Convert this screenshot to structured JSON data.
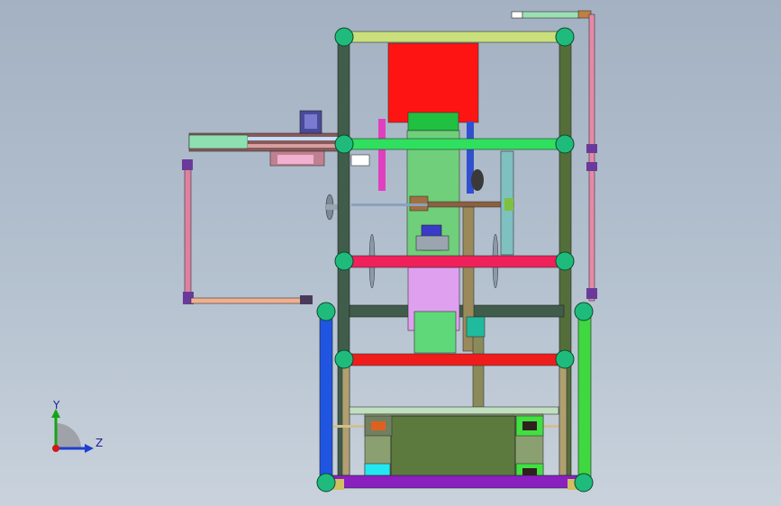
{
  "viewport": {
    "background_top": "#a3b1c2",
    "background_bottom": "#c9d2dc"
  },
  "triad": {
    "y_label": "Y",
    "z_label": "Z",
    "colors": {
      "y": "#16a316",
      "z": "#1f3fd0",
      "x": "#d01818"
    }
  },
  "colors": {
    "frame_post": "#3f5d4a",
    "joint_ball": "#1fbb7c",
    "top_beam": "#c9e07c",
    "green_beam": "#2ee05e",
    "pink_beam": "#f0205a",
    "red_beam": "#f01c1c",
    "red_block": "#ff1414",
    "pale_green_column": "#6fcf7a",
    "violet_block": "#e0a0f0",
    "olive_panel": "#5c7a3e",
    "blue_post": "#1f55e0",
    "lime_post": "#40d840",
    "cyan_box": "#24e8f0",
    "side_frame_pink": "#e080a0",
    "orange_arm": "#f0b090",
    "purple_base": "#8a20c0"
  }
}
